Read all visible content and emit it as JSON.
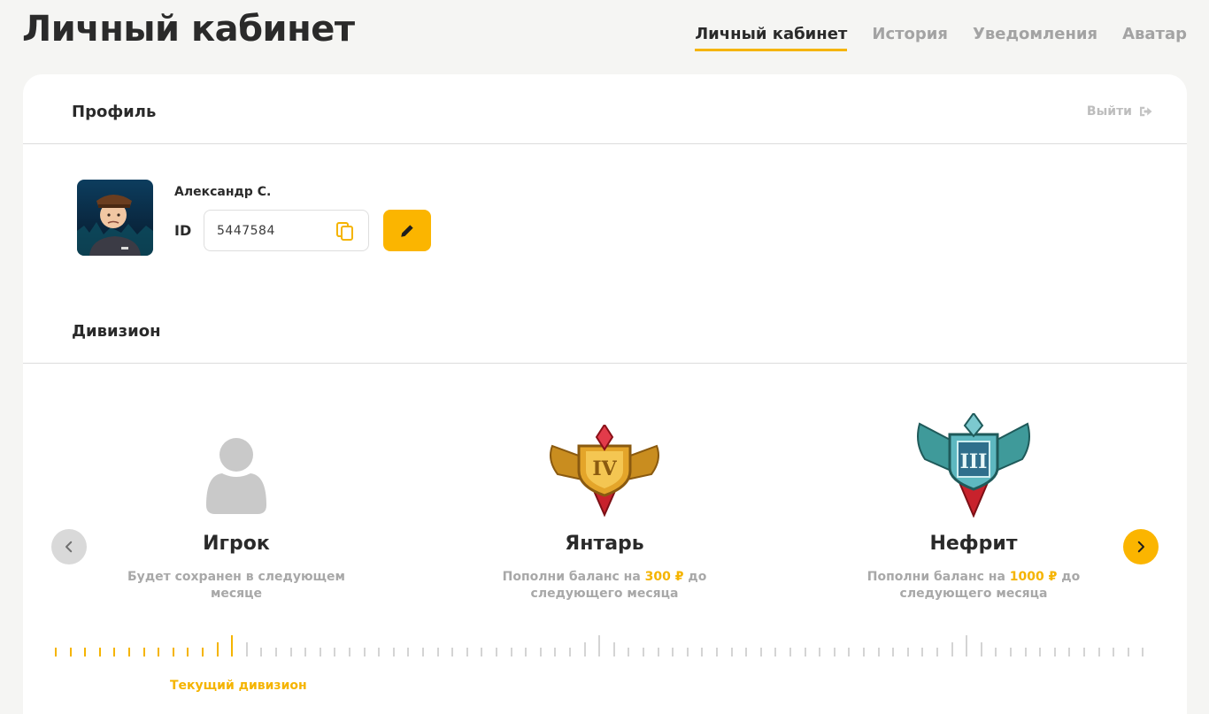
{
  "header": {
    "title": "Личный кабинет",
    "tabs": [
      {
        "label": "Личный кабинет",
        "active": true
      },
      {
        "label": "История",
        "active": false
      },
      {
        "label": "Уведомления",
        "active": false
      },
      {
        "label": "Аватар",
        "active": false
      }
    ]
  },
  "profile": {
    "section_title": "Профиль",
    "logout_label": "Выйти",
    "user_name": "Александр С.",
    "id_label": "ID",
    "id_value": "5447584"
  },
  "division": {
    "section_title": "Дивизион",
    "items": [
      {
        "name": "Игрок",
        "desc": "Будет сохранен в следующем месяце",
        "icon": "user-placeholder-icon"
      },
      {
        "name": "Янтарь",
        "desc_before": "Пополни баланс на ",
        "amount": "300 ₽",
        "desc_after": " до следующего месяца",
        "icon": "amber-rank-badge-icon"
      },
      {
        "name": "Нефрит",
        "desc_before": "Пополни баланс на ",
        "amount": "1000 ₽",
        "desc_after": " до следующего месяца",
        "icon": "jade-rank-badge-icon"
      }
    ],
    "current_label": "Текущий дивизион",
    "progress": {
      "total_ticks": 75,
      "filled_ticks": 13
    }
  },
  "colors": {
    "accent": "#fbb500",
    "text": "#2a2a2a",
    "muted": "#a8a8a8",
    "background": "#f5f5f3"
  }
}
